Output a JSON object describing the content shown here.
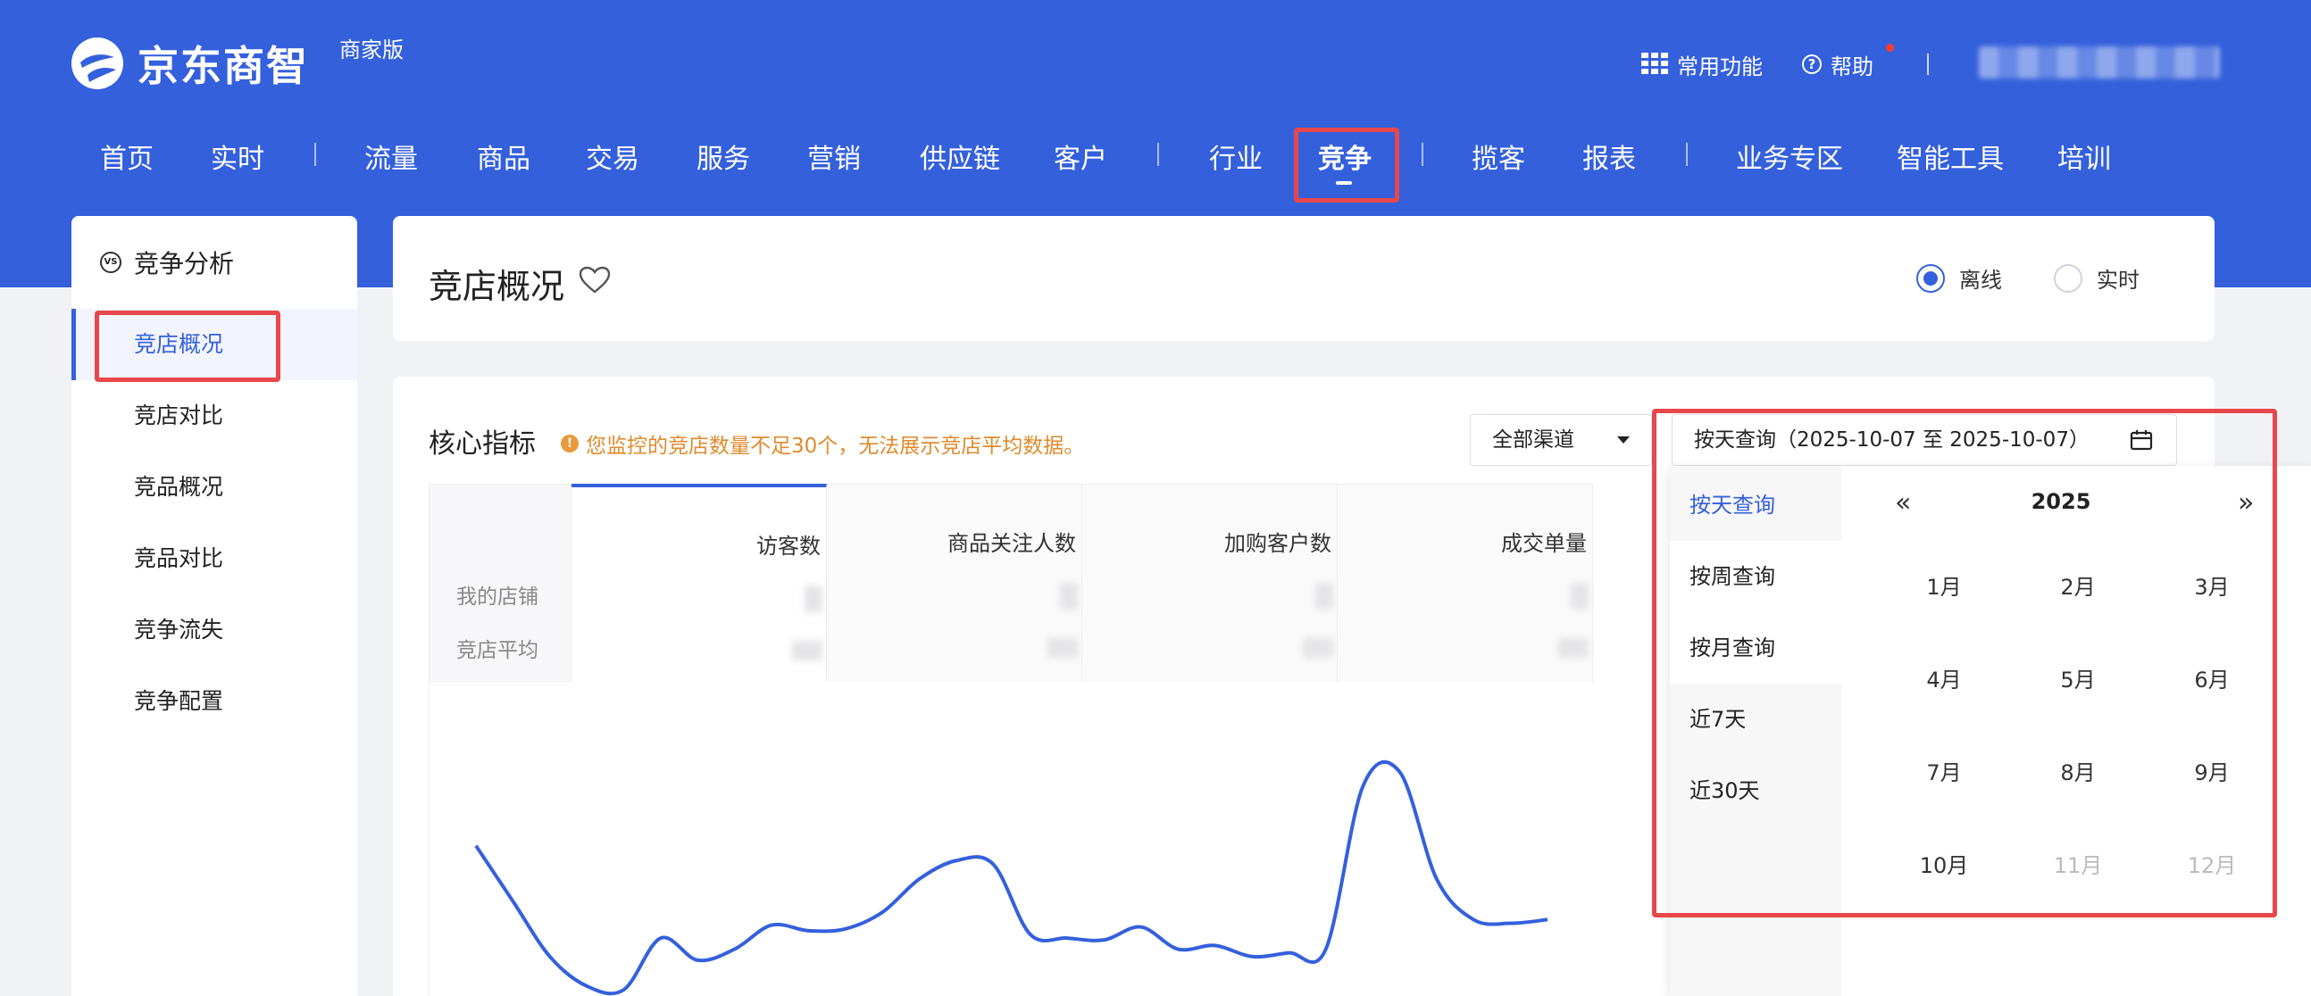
{
  "header": {
    "logo_text": "京东商智",
    "logo_sub": "商家版",
    "common_functions": "常用功能",
    "help": "帮助"
  },
  "nav": {
    "items": [
      "首页",
      "实时",
      "流量",
      "商品",
      "交易",
      "服务",
      "营销",
      "供应链",
      "客户",
      "行业",
      "竞争",
      "揽客",
      "报表",
      "业务专区",
      "智能工具",
      "培训"
    ],
    "active": "竞争"
  },
  "sidebar": {
    "title": "竞争分析",
    "items": [
      "竞店概况",
      "竞店对比",
      "竞品概况",
      "竞品对比",
      "竞争流失",
      "竞争配置"
    ],
    "active": "竞店概况"
  },
  "page": {
    "title": "竞店概况",
    "mode_options": [
      "离线",
      "实时"
    ],
    "mode_selected": "离线"
  },
  "core": {
    "title": "核心指标",
    "warning": "您监控的竞店数量不足30个，无法展示竞店平均数据。",
    "channel": "全部渠道",
    "date_range": "按天查询（2025-10-07 至 2025-10-07）",
    "row_labels": [
      "我的店铺",
      "竞店平均"
    ],
    "metrics": [
      "访客数",
      "商品关注人数",
      "加购客户数",
      "成交单量"
    ],
    "active_metric": "访客数"
  },
  "date_popup": {
    "options": [
      "按天查询",
      "按周查询",
      "按月查询",
      "近7天",
      "近30天"
    ],
    "active_option": "按天查询",
    "year": "2025",
    "prev_icon": "«",
    "next_icon": "»",
    "months": [
      "1月",
      "2月",
      "3月",
      "4月",
      "5月",
      "6月",
      "7月",
      "8月",
      "9月",
      "10月",
      "11月",
      "12月"
    ],
    "disabled_months": [
      "11月",
      "12月"
    ]
  },
  "colors": {
    "brand_blue": "#3460dc",
    "highlight_red": "#e8474b",
    "warning_orange": "#e08a2c"
  },
  "chart_data": {
    "type": "line",
    "series": [
      {
        "values": [
          78,
          48,
          18,
          2,
          0,
          28,
          16,
          22,
          35,
          32,
          33,
          42,
          60,
          70,
          68,
          30,
          28,
          27,
          34,
          22,
          24,
          18,
          20,
          22,
          110,
          118,
          60,
          38,
          36,
          38
        ]
      }
    ],
    "ylim": [
      0,
      150
    ]
  }
}
